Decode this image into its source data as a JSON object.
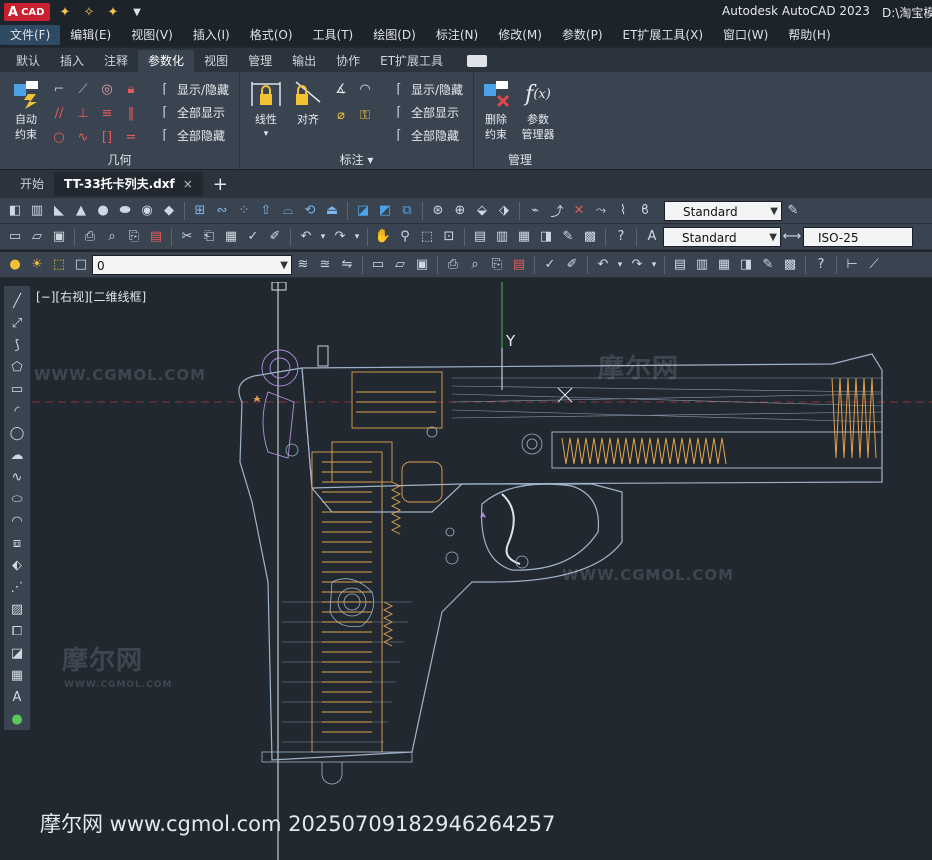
{
  "title_bar": {
    "logo_letter": "A",
    "logo_text": "CAD",
    "app_title": "Autodesk AutoCAD 2023",
    "doc_path": "D:\\淘宝模"
  },
  "menu": [
    "文件(F)",
    "编辑(E)",
    "视图(V)",
    "插入(I)",
    "格式(O)",
    "工具(T)",
    "绘图(D)",
    "标注(N)",
    "修改(M)",
    "参数(P)",
    "ET扩展工具(X)",
    "窗口(W)",
    "帮助(H)"
  ],
  "ribbon_tabs": [
    "默认",
    "插入",
    "注释",
    "参数化",
    "视图",
    "管理",
    "输出",
    "协作",
    "ET扩展工具"
  ],
  "ribbon_active_tab": "参数化",
  "ribbon": {
    "geometry": {
      "label": "几何",
      "auto_constrain_line1": "自动",
      "auto_constrain_line2": "约束",
      "show_hide": "显示/隐藏",
      "show_all": "全部显示",
      "hide_all": "全部隐藏"
    },
    "dimension": {
      "label": "标注",
      "linear": "线性",
      "aligned": "对齐",
      "show_hide": "显示/隐藏",
      "show_all": "全部显示",
      "hide_all": "全部隐藏"
    },
    "manage": {
      "label": "管理",
      "delete_line1": "删除",
      "delete_line2": "约束",
      "params_line1": "参数",
      "params_line2": "管理器"
    }
  },
  "doc_tabs": {
    "start": "开始",
    "active": "TT-33托卡列夫.dxf",
    "close_glyph": "×",
    "add_glyph": "+"
  },
  "toolbars": {
    "visual_style": "Standard",
    "text_style": "Standard",
    "dim_style": "ISO-25",
    "layer": "0"
  },
  "viewport": {
    "label": "[−][右视][二维线框]",
    "ucs_y": "Y"
  },
  "watermarks": {
    "logo_cn": "摩尔网",
    "logo_en": "WWW.CGMOL.COM",
    "footer": "摩尔网 www.cgmol.com 20250709182946264257"
  },
  "colors": {
    "accent_red": "#c8202e",
    "canvas_bg": "#212830",
    "ribbon_bg": "#3a4450",
    "drawing_blue": "#9fb3c8",
    "drawing_orange": "#e3a24e",
    "drawing_purple": "#b391e0"
  }
}
